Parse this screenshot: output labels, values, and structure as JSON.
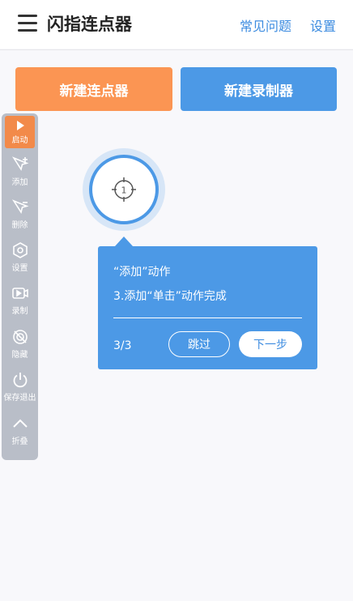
{
  "header": {
    "title": "闪指连点器",
    "faq_label": "常见问题",
    "settings_label": "设置",
    "menu_icon": "hamburger-menu-icon"
  },
  "actions": {
    "new_clicker_label": "新建连点器",
    "new_recorder_label": "新建录制器"
  },
  "panel": {
    "items": [
      {
        "label": "启动",
        "icon": "play-icon"
      },
      {
        "label": "添加",
        "icon": "add-cursor-icon"
      },
      {
        "label": "删除",
        "icon": "remove-cursor-icon"
      },
      {
        "label": "设置",
        "icon": "hexagon-gear-icon"
      },
      {
        "label": "录制",
        "icon": "record-video-icon"
      },
      {
        "label": "隐藏",
        "icon": "hide-eye-icon"
      },
      {
        "label": "保存退出",
        "icon": "power-icon"
      },
      {
        "label": "折叠",
        "icon": "chevron-up-icon"
      }
    ]
  },
  "target": {
    "number": "1"
  },
  "tooltip": {
    "title": "“添加”动作",
    "description": "3.添加“单击”动作完成",
    "step": "3/3",
    "skip_label": "跳过",
    "next_label": "下一步"
  },
  "colors": {
    "orange": "#fb9553",
    "blue": "#4c99e6",
    "panel": "#b9bec8"
  }
}
